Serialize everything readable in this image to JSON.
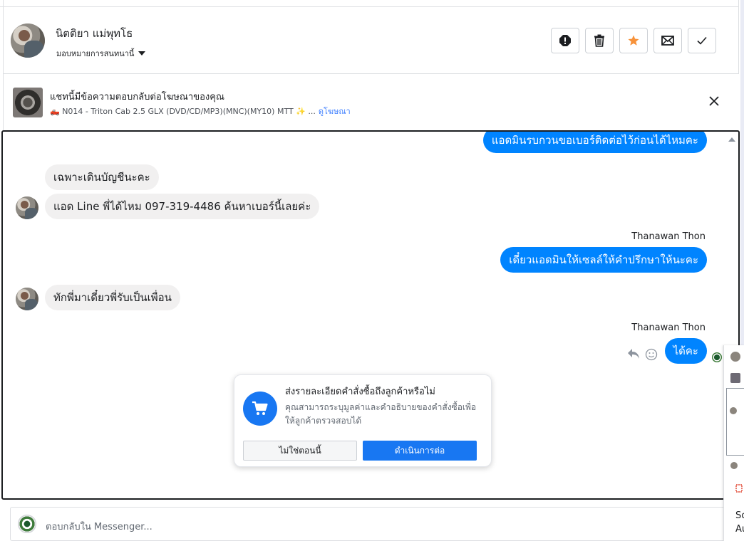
{
  "header": {
    "name": "นิตติยา แม่พุทโธ",
    "assign_label": "มอบหมายการสนทนานี้",
    "buttons": [
      "spam",
      "delete",
      "star",
      "mark-unread",
      "done"
    ]
  },
  "ad": {
    "title": "แชทนี้มีข้อความตอบกลับต่อโฆษณาของคุณ",
    "product": "🛻 N014 - Triton Cab 2.5 GLX (DVD/CD/MP3)(MNC)(MY10) MTT ✨ ...",
    "link_label": "ดูโฆษณา"
  },
  "messages": {
    "m1": "แอดมินรบกวนขอเบอร์ติดต่อไว้ก่อนได้ไหมคะ",
    "m2": "เฉพาะเดินบัญชีนะคะ",
    "m3": "แอด Line พี่ได้ไหม 097-319-4486 ค้นหาเบอร์นี้เลยค่ะ",
    "sender1": "Thanawan Thon",
    "m4": "เดี๋ยวแอดมินให้เซลล์ให้คำปรึกษาให้นะคะ",
    "m5": "ทักพี่มาเดี๋ยวพี่รับเป็นเพื่อน",
    "sender2": "Thanawan Thon",
    "m6": "ได้คะ"
  },
  "order_prompt": {
    "title": "ส่งรายละเอียดคำสั่งซื้อถึงลูกค้าหรือไม่",
    "description": "คุณสามารถระบุมูลค่าและคำอธิบายของคำสั่งซื้อเพื่อให้ลูกค้าตรวจสอบได้",
    "cancel_label": "ไม่ใช่ตอนนี้",
    "continue_label": "ดำเนินการต่อ"
  },
  "composer": {
    "placeholder": "ตอบกลับใน Messenger..."
  },
  "side_panel": {
    "text1": "Sc",
    "text2": "Au"
  },
  "colors": {
    "accent": "#1877f2",
    "outgoing_bubble": "#0084ff",
    "incoming_bubble": "#f1f0f0",
    "star": "#f7923a"
  }
}
